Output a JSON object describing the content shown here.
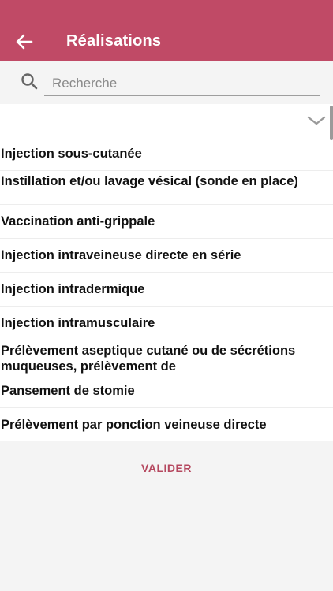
{
  "header": {
    "title": "Réalisations",
    "back_icon": "arrow-left-icon",
    "background_color": "#c04a66"
  },
  "search": {
    "placeholder": "Recherche",
    "value": "",
    "icon": "search-icon"
  },
  "dropdown": {
    "selected": "",
    "icon": "chevron-down-icon"
  },
  "items": [
    {
      "label": "Injection sous-cutanée"
    },
    {
      "label": "Instillation et/ou lavage vésical (sonde en place)"
    },
    {
      "label": "Vaccination anti-grippale"
    },
    {
      "label": "Injection intraveineuse directe en série"
    },
    {
      "label": "Injection intradermique"
    },
    {
      "label": "Injection intramusculaire"
    },
    {
      "label": "Prélèvement aseptique cutané ou de sécrétions muqueuses, prélèvement de"
    },
    {
      "label": "Pansement de stomie"
    },
    {
      "label": "Prélèvement par ponction veineuse directe"
    }
  ],
  "footer": {
    "validate_label": "VALIDER",
    "accent_color": "#b5485f"
  }
}
